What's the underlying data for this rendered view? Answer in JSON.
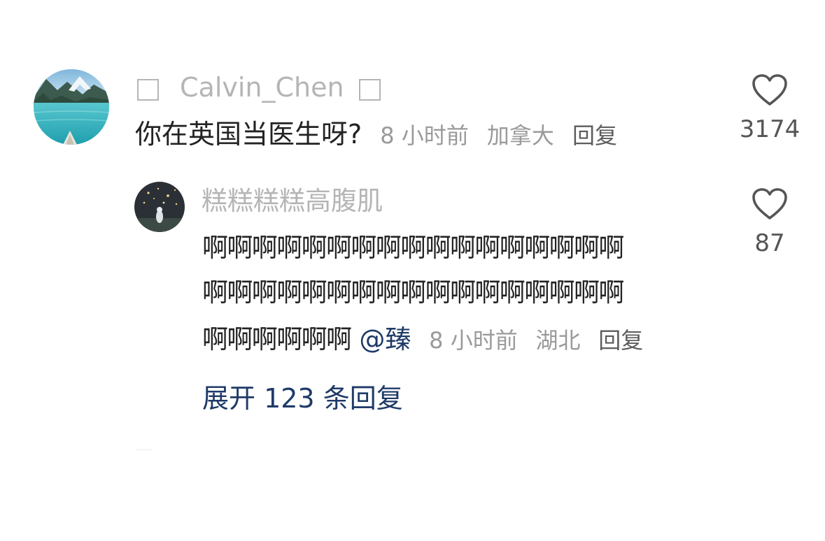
{
  "comment": {
    "avatar_icon": "landscape-lake-avatar",
    "username": "Calvin_Chen",
    "text": "你在英国当医生呀?",
    "time": "8 小时前",
    "location": "加拿大",
    "reply_label": "回复",
    "like_icon": "heart-outline-icon",
    "like_count": "3174"
  },
  "reply": {
    "avatar_icon": "night-sky-figure-avatar",
    "username": "糕糕糕糕高腹肌",
    "text_lines": [
      "啊啊啊啊啊啊啊啊啊啊啊啊啊啊啊啊啊",
      "啊啊啊啊啊啊啊啊啊啊啊啊啊啊啊啊啊",
      "啊啊啊啊啊啊"
    ],
    "mention": "@臻",
    "time": "8 小时前",
    "location": "湖北",
    "reply_label": "回复",
    "like_icon": "heart-outline-icon",
    "like_count": "87"
  },
  "expand_replies_label": "展开 123 条回复",
  "colors": {
    "username": "#b5b5b5",
    "meta": "#9a9a9a",
    "link_blue": "#1f3a68",
    "body_text": "#222222"
  }
}
